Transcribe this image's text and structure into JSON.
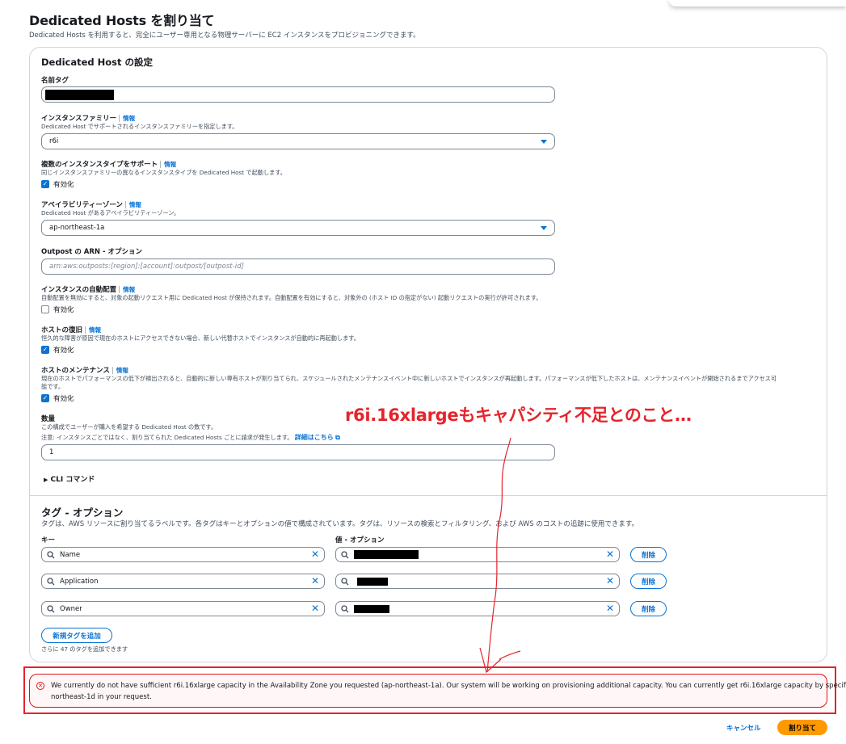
{
  "page": {
    "title": "Dedicated Hosts を割り当て",
    "description": "Dedicated Hosts を利用すると、完全にユーザー専用となる物理サーバーに EC2 インスタンスをプロビジョニングできます。"
  },
  "settings": {
    "title": "Dedicated Host の設定",
    "name_tag": {
      "label": "名前タグ"
    },
    "instance_family": {
      "label": "インスタンスファミリー",
      "info": "情報",
      "description": "Dedicated Host でサポートされるインスタンスファミリーを指定します。",
      "value": "r6i"
    },
    "multi_type": {
      "label": "複数のインスタンスタイプをサポート",
      "info": "情報",
      "description": "同じインスタンスファミリーの異なるインスタンスタイプを Dedicated Host で起動します。",
      "checkbox_label": "有効化",
      "checked": true
    },
    "availability_zone": {
      "label": "アベイラビリティーゾーン",
      "info": "情報",
      "description": "Dedicated Host があるアベイラビリティーゾーン。",
      "value": "ap-northeast-1a"
    },
    "outpost": {
      "label": "Outpost の ARN - オプション",
      "placeholder": "arn:aws:outposts:[region]:[account]:outpost/[outpost-id]"
    },
    "auto_placement": {
      "label": "インスタンスの自動配置",
      "info": "情報",
      "description": "自動配置を無効にすると、対象の起動リクエスト用に Dedicated Host が保持されます。自動配置を有効にすると、対象外の (ホスト ID の指定がない) 起動リクエストの実行が許可されます。",
      "checkbox_label": "有効化",
      "checked": false
    },
    "host_recovery": {
      "label": "ホストの復旧",
      "info": "情報",
      "description": "恒久的な障害が原因で現在のホストにアクセスできない場合、新しい代替ホストでインスタンスが自動的に再起動します。",
      "checkbox_label": "有効化",
      "checked": true
    },
    "host_maintenance": {
      "label": "ホストのメンテナンス",
      "info": "情報",
      "description_line1": "現在のホストでパフォーマンスの低下が検出されると、自動的に新しい専有ホストが割り当てられ、スケジュールされたメンテナンスイベント中に新しいホストでインスタンスが再起動します。パフォーマンスが低下したホストは、メンテナンスイベントが開始されるまでアクセス可",
      "description_line2": "能です。",
      "checkbox_label": "有効化",
      "checked": true
    },
    "quantity": {
      "label": "数量",
      "description": "この構成でユーザーが購入を希望する Dedicated Host の数です。",
      "note": "注意: インスタンスごとではなく、割り当てられた Dedicated Hosts ごとに請求が発生します。",
      "note_link": "詳細はこちら",
      "value": "1"
    },
    "cli_label": "CLI コマンド"
  },
  "tags": {
    "title": "タグ - オプション",
    "description": "タグは、AWS リソースに割り当てるラベルです。各タグはキーとオプションの値で構成されています。タグは、リソースの検索とフィルタリング、および AWS のコストの追跡に使用できます。",
    "key_header": "キー",
    "value_header": "値 - オプション",
    "rows": [
      {
        "key": "Name",
        "remove": "削除"
      },
      {
        "key": "Application",
        "remove": "削除"
      },
      {
        "key": "Owner",
        "remove": "削除"
      }
    ],
    "add_button": "新規タグを追加",
    "remaining": "さらに 47 のタグを追加できます"
  },
  "annotation": "r6i.16xlargeもキャパシティ不足とのこと…",
  "error": {
    "line1": "We currently do not have sufficient r6i.16xlarge capacity in the Availability Zone you requested (ap-northeast-1a). Our system will be working on provisioning additional capacity. You can currently get r6i.16xlarge capacity by specifying ap-",
    "line2": "northeast-1d in your request."
  },
  "footer": {
    "cancel": "キャンセル",
    "submit": "割り当て"
  },
  "colors": {
    "link": "#0972d3",
    "primary": "#ff9900",
    "error": "#d91515",
    "annotation": "#e6232b"
  }
}
